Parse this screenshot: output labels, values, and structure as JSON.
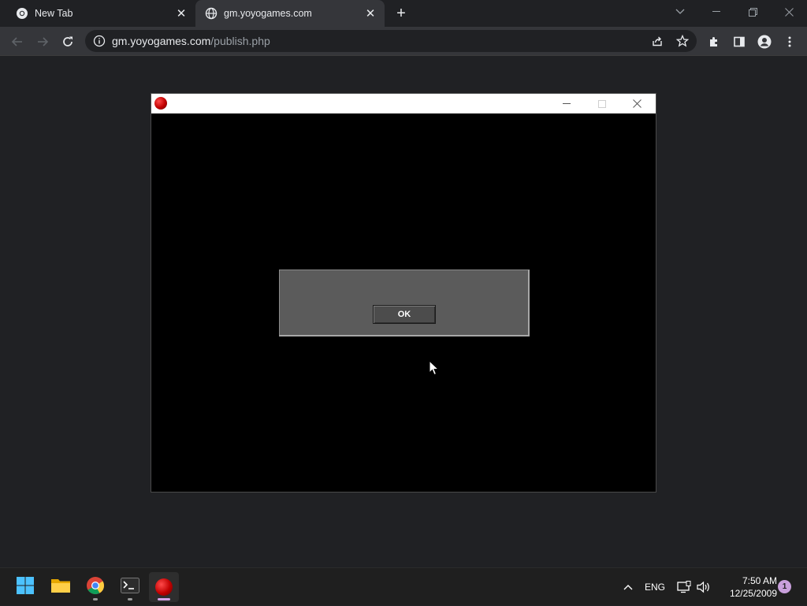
{
  "browser": {
    "tabs": [
      {
        "title": "New Tab",
        "icon": "chrome-icon",
        "active": false
      },
      {
        "title": "gm.yoyogames.com",
        "icon": "globe-icon",
        "active": true
      }
    ],
    "address": {
      "host": "gm.yoyogames.com",
      "path": "/publish.php"
    }
  },
  "game_window": {
    "title": "",
    "icon": "red-ball-icon",
    "dialog": {
      "message": "",
      "ok_label": "OK"
    }
  },
  "taskbar": {
    "apps": [
      {
        "name": "start-button",
        "icon": "windows-icon"
      },
      {
        "name": "file-explorer",
        "icon": "folder-icon"
      },
      {
        "name": "chrome",
        "icon": "chrome-icon"
      },
      {
        "name": "terminal",
        "icon": "terminal-icon"
      },
      {
        "name": "game",
        "icon": "red-ball-icon"
      }
    ],
    "language": "ENG",
    "time": "7:50 AM",
    "date": "12/25/2009",
    "notification_count": "1"
  },
  "colors": {
    "browser_bg": "#202124",
    "toolbar_bg": "#35363a",
    "dialog_bg": "#5b5b5b",
    "taskbar_bg": "#1f1f1f",
    "accent": "#d3a2e6"
  }
}
